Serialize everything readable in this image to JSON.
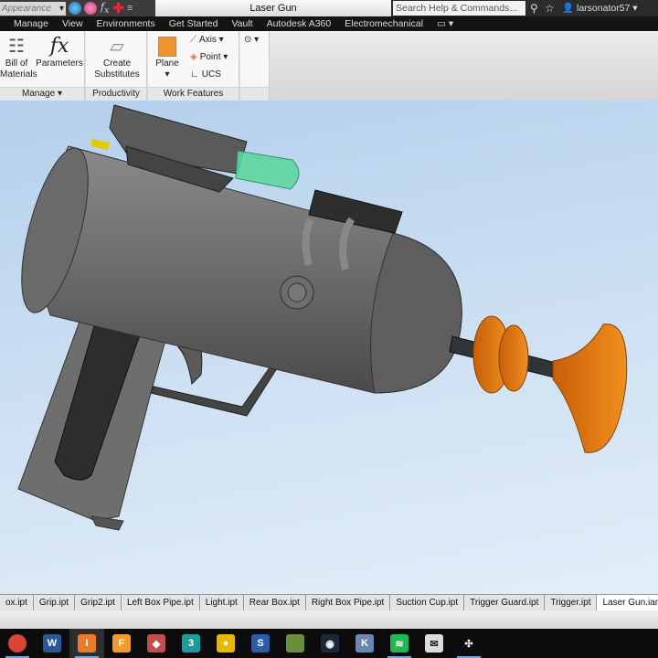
{
  "titlebar": {
    "appearance": "Appearance",
    "title": "Laser Gun",
    "search_placeholder": "Search Help & Commands...",
    "user": "larsonator57"
  },
  "menu": [
    "Manage",
    "View",
    "Environments",
    "Get Started",
    "Vault",
    "Autodesk A360",
    "Electromechanical"
  ],
  "ribbon": {
    "manage": {
      "label": "Manage ▾",
      "bom": "Bill of Materials",
      "parameters": "Parameters"
    },
    "productivity": {
      "label": "Productivity",
      "create_substitutes": "Create Substitutes"
    },
    "work_features": {
      "label": "Work Features",
      "plane": "Plane",
      "axis": "Axis ▾",
      "point": "Point ▾",
      "ucs": "UCS"
    }
  },
  "tabs": [
    "ox.ipt",
    "Grip.ipt",
    "Grip2.ipt",
    "Left Box Pipe.ipt",
    "Light.ipt",
    "Rear Box.ipt",
    "Right Box Pipe.ipt",
    "Suction Cup.ipt",
    "Trigger Guard.ipt",
    "Trigger.ipt",
    "Laser Gun.iam"
  ],
  "active_tab": "Laser Gun.iam",
  "taskbar": [
    {
      "icon": "chrome-icon",
      "color": "#db4437",
      "glyph": "",
      "on": true
    },
    {
      "icon": "word-icon",
      "color": "#2b5797",
      "glyph": "W",
      "on": false
    },
    {
      "icon": "inventor-icon",
      "color": "#e87a2a",
      "glyph": "I",
      "on": true,
      "active": true
    },
    {
      "icon": "fusion-icon",
      "color": "#f29a2e",
      "glyph": "F",
      "on": false
    },
    {
      "icon": "gem-icon",
      "color": "#c0504d",
      "glyph": "◆",
      "on": false
    },
    {
      "icon": "3dsmax-icon",
      "color": "#1a9c9c",
      "glyph": "3",
      "on": false
    },
    {
      "icon": "app-icon",
      "color": "#e8b800",
      "glyph": "●",
      "on": false
    },
    {
      "icon": "sketchbook-icon",
      "color": "#2a5ea8",
      "glyph": "S",
      "on": false
    },
    {
      "icon": "minecraft-icon",
      "color": "#6a8e3a",
      "glyph": "",
      "on": false
    },
    {
      "icon": "steam-icon",
      "color": "#1b2838",
      "glyph": "◉",
      "on": false
    },
    {
      "icon": "document-icon",
      "color": "#6b86b0",
      "glyph": "K",
      "on": false
    },
    {
      "icon": "spotify-icon",
      "color": "#1db954",
      "glyph": "≋",
      "on": true
    },
    {
      "icon": "mail-icon",
      "color": "#ddd",
      "glyph": "✉",
      "on": false
    },
    {
      "icon": "spinner-icon",
      "color": "#0c0c0c",
      "glyph": "✣",
      "on": true
    }
  ]
}
